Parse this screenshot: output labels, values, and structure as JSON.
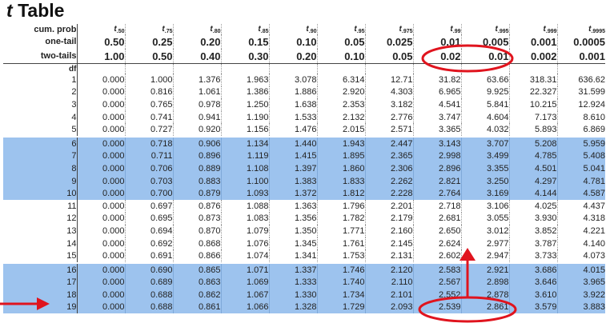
{
  "title": {
    "italic": "t",
    "rest": "Table"
  },
  "header": {
    "cum_prob_label": "cum. prob",
    "one_tail_label": "one-tail",
    "two_tails_label": "two-tails",
    "df_label": "df",
    "subscripts": [
      ".50",
      ".75",
      ".80",
      ".85",
      ".90",
      ".95",
      ".975",
      ".99",
      ".995",
      ".999",
      ".9995"
    ],
    "one_tail": [
      "0.50",
      "0.25",
      "0.20",
      "0.15",
      "0.10",
      "0.05",
      "0.025",
      "0.01",
      "0.005",
      "0.001",
      "0.0005"
    ],
    "two_tails": [
      "1.00",
      "0.50",
      "0.40",
      "0.30",
      "0.20",
      "0.10",
      "0.05",
      "0.02",
      "0.01",
      "0.002",
      "0.001"
    ]
  },
  "rows": [
    {
      "df": "1",
      "v": [
        "0.000",
        "1.000",
        "1.376",
        "1.963",
        "3.078",
        "6.314",
        "12.71",
        "31.82",
        "63.66",
        "318.31",
        "636.62"
      ]
    },
    {
      "df": "2",
      "v": [
        "0.000",
        "0.816",
        "1.061",
        "1.386",
        "1.886",
        "2.920",
        "4.303",
        "6.965",
        "9.925",
        "22.327",
        "31.599"
      ]
    },
    {
      "df": "3",
      "v": [
        "0.000",
        "0.765",
        "0.978",
        "1.250",
        "1.638",
        "2.353",
        "3.182",
        "4.541",
        "5.841",
        "10.215",
        "12.924"
      ]
    },
    {
      "df": "4",
      "v": [
        "0.000",
        "0.741",
        "0.941",
        "1.190",
        "1.533",
        "2.132",
        "2.776",
        "3.747",
        "4.604",
        "7.173",
        "8.610"
      ]
    },
    {
      "df": "5",
      "v": [
        "0.000",
        "0.727",
        "0.920",
        "1.156",
        "1.476",
        "2.015",
        "2.571",
        "3.365",
        "4.032",
        "5.893",
        "6.869"
      ]
    },
    {
      "df": "6",
      "v": [
        "0.000",
        "0.718",
        "0.906",
        "1.134",
        "1.440",
        "1.943",
        "2.447",
        "3.143",
        "3.707",
        "5.208",
        "5.959"
      ]
    },
    {
      "df": "7",
      "v": [
        "0.000",
        "0.711",
        "0.896",
        "1.119",
        "1.415",
        "1.895",
        "2.365",
        "2.998",
        "3.499",
        "4.785",
        "5.408"
      ]
    },
    {
      "df": "8",
      "v": [
        "0.000",
        "0.706",
        "0.889",
        "1.108",
        "1.397",
        "1.860",
        "2.306",
        "2.896",
        "3.355",
        "4.501",
        "5.041"
      ]
    },
    {
      "df": "9",
      "v": [
        "0.000",
        "0.703",
        "0.883",
        "1.100",
        "1.383",
        "1.833",
        "2.262",
        "2.821",
        "3.250",
        "4.297",
        "4.781"
      ]
    },
    {
      "df": "10",
      "v": [
        "0.000",
        "0.700",
        "0.879",
        "1.093",
        "1.372",
        "1.812",
        "2.228",
        "2.764",
        "3.169",
        "4.144",
        "4.587"
      ]
    },
    {
      "df": "11",
      "v": [
        "0.000",
        "0.697",
        "0.876",
        "1.088",
        "1.363",
        "1.796",
        "2.201",
        "2.718",
        "3.106",
        "4.025",
        "4.437"
      ]
    },
    {
      "df": "12",
      "v": [
        "0.000",
        "0.695",
        "0.873",
        "1.083",
        "1.356",
        "1.782",
        "2.179",
        "2.681",
        "3.055",
        "3.930",
        "4.318"
      ]
    },
    {
      "df": "13",
      "v": [
        "0.000",
        "0.694",
        "0.870",
        "1.079",
        "1.350",
        "1.771",
        "2.160",
        "2.650",
        "3.012",
        "3.852",
        "4.221"
      ]
    },
    {
      "df": "14",
      "v": [
        "0.000",
        "0.692",
        "0.868",
        "1.076",
        "1.345",
        "1.761",
        "2.145",
        "2.624",
        "2.977",
        "3.787",
        "4.140"
      ]
    },
    {
      "df": "15",
      "v": [
        "0.000",
        "0.691",
        "0.866",
        "1.074",
        "1.341",
        "1.753",
        "2.131",
        "2.602",
        "2.947",
        "3.733",
        "4.073"
      ]
    },
    {
      "df": "16",
      "v": [
        "0.000",
        "0.690",
        "0.865",
        "1.071",
        "1.337",
        "1.746",
        "2.120",
        "2.583",
        "2.921",
        "3.686",
        "4.015"
      ]
    },
    {
      "df": "17",
      "v": [
        "0.000",
        "0.689",
        "0.863",
        "1.069",
        "1.333",
        "1.740",
        "2.110",
        "2.567",
        "2.898",
        "3.646",
        "3.965"
      ]
    },
    {
      "df": "18",
      "v": [
        "0.000",
        "0.688",
        "0.862",
        "1.067",
        "1.330",
        "1.734",
        "2.101",
        "2.552",
        "2.878",
        "3.610",
        "3.922"
      ]
    },
    {
      "df": "19",
      "v": [
        "0.000",
        "0.688",
        "0.861",
        "1.066",
        "1.328",
        "1.729",
        "2.093",
        "2.539",
        "2.861",
        "3.579",
        "3.883"
      ]
    }
  ],
  "highlight_color": "#9dc3ee",
  "annotation_color": "#e0141e"
}
